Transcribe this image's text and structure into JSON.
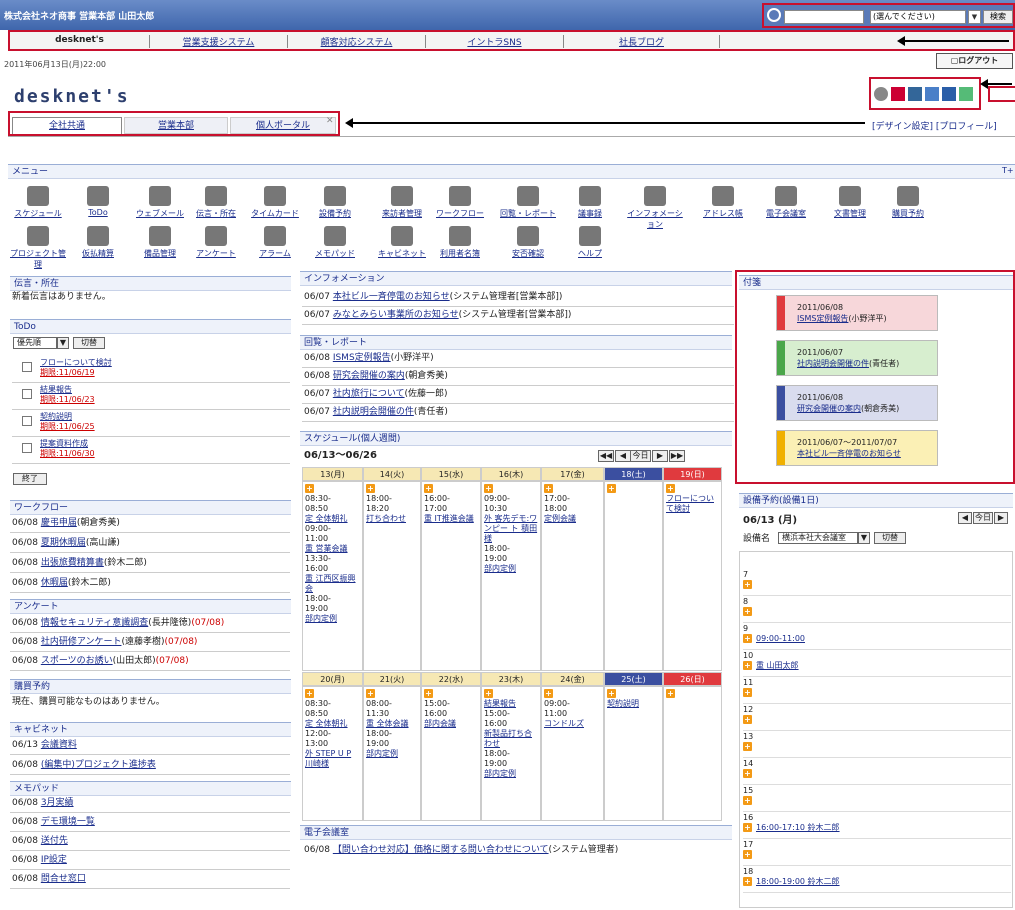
{
  "topbar": {
    "user": "株式会社ネオ商事 営業本部 山田太郎",
    "search_placeholder": "",
    "select_value": "(選んでください)",
    "search_button": "検索"
  },
  "nav": [
    "desknet's",
    "営業支援システム",
    "顧客対応システム",
    "イントラSNS",
    "社長ブログ"
  ],
  "date": "2011年06月13日(月)22:00",
  "logout": "ログアウト",
  "logo": "desknet's",
  "tabs": [
    "全社共通",
    "営業本部",
    "個人ポータル"
  ],
  "top_right": "[デザイン設定] [プロフィール]",
  "menu": {
    "title": "メニュー",
    "items1": [
      "スケジュール",
      "ToDo",
      "ウェブメール",
      "伝言・所在",
      "タイムカード",
      "設備予約",
      "来訪者管理",
      "ワークフロー",
      "回覧・レポート",
      "議事録",
      "インフォメーション",
      "アドレス帳",
      "電子会議室",
      "文書管理",
      "購買予約"
    ],
    "items2": [
      "プロジェクト管理",
      "仮払精算",
      "備品管理",
      "アンケート",
      "アラーム",
      "メモパッド",
      "キャビネット",
      "利用者名簿",
      "安否確認",
      "ヘルプ"
    ]
  },
  "dengon": {
    "title": "伝言・所在",
    "text": "新着伝言はありません。"
  },
  "todo": {
    "title": "ToDo",
    "sort": "優先順",
    "switch": "切替",
    "items": [
      {
        "t": "フローについて検討",
        "d": "期限:11/06/19"
      },
      {
        "t": "結果報告",
        "d": "期限:11/06/23"
      },
      {
        "t": "契約説明",
        "d": "期限:11/06/25"
      },
      {
        "t": "提案資料作成",
        "d": "期限:11/06/30"
      }
    ],
    "done": "終了"
  },
  "workflow": {
    "title": "ワークフロー",
    "rows": [
      {
        "d": "06/08",
        "l": "慶弔申届",
        "w": "(朝倉秀美)"
      },
      {
        "d": "06/08",
        "l": "夏期休暇届",
        "w": "(高山謙)"
      },
      {
        "d": "06/08",
        "l": "出張旅費精算書",
        "w": "(鈴木二郎)"
      },
      {
        "d": "06/08",
        "l": "休暇届",
        "w": "(鈴木二郎)"
      }
    ]
  },
  "enquete": {
    "title": "アンケート",
    "rows": [
      {
        "d": "06/08",
        "l": "情報セキュリティ意識調査",
        "w": "(長井隆徳)",
        "x": "(07/08)"
      },
      {
        "d": "06/08",
        "l": "社内研修アンケート",
        "w": "(遠藤孝樹)",
        "x": "(07/08)"
      },
      {
        "d": "06/08",
        "l": "スポーツのお誘い",
        "w": "(山田太郎)",
        "x": "(07/08)"
      }
    ]
  },
  "kobai": {
    "title": "購買予約",
    "text": "現在、購買可能なものはありません。"
  },
  "cabinet": {
    "title": "キャビネット",
    "rows": [
      {
        "d": "06/13",
        "l": "会議資料"
      },
      {
        "d": "06/08",
        "l": "(編集中)プロジェクト進捗表"
      }
    ]
  },
  "memo": {
    "title": "メモパッド",
    "rows": [
      {
        "d": "06/08",
        "l": "3月実績"
      },
      {
        "d": "06/08",
        "l": "デモ環境一覧"
      },
      {
        "d": "06/08",
        "l": "送付先"
      },
      {
        "d": "06/08",
        "l": "IP設定"
      },
      {
        "d": "06/08",
        "l": "問合せ窓口"
      }
    ]
  },
  "info": {
    "title": "インフォメーション",
    "rows": [
      {
        "d": "06/07",
        "l": "本社ビル一斉停電のお知らせ",
        "w": "(システム管理者[営業本部])"
      },
      {
        "d": "06/07",
        "l": "みなとみらい事業所のお知らせ",
        "w": "(システム管理者[営業本部])"
      }
    ]
  },
  "kairan": {
    "title": "回覧・レポート",
    "rows": [
      {
        "d": "06/08",
        "l": "ISMS定例報告",
        "w": "(小野洋平)"
      },
      {
        "d": "06/08",
        "l": "研究会開催の案内",
        "w": "(朝倉秀美)"
      },
      {
        "d": "06/07",
        "l": "社内旅行について",
        "w": "(佐藤一郎)"
      },
      {
        "d": "06/07",
        "l": "社内説明会開催の件",
        "w": "(青任者)"
      }
    ]
  },
  "schedule": {
    "title": "スケジュール(個人週間)",
    "range": "06/13〜06/26",
    "week1": [
      "13(月)",
      "14(火)",
      "15(水)",
      "16(木)",
      "17(金)",
      "18(土)",
      "19(日)"
    ],
    "week2": [
      "20(月)",
      "21(火)",
      "22(水)",
      "23(木)",
      "24(金)",
      "25(土)",
      "26(日)"
    ],
    "w1": [
      [
        "08:30-",
        "08:50",
        "定 全体朝礼",
        "09:00-",
        "11:00",
        "重 営業会議",
        "13:30-",
        "16:00",
        "重 江西区振興会",
        "18:00-",
        "19:00",
        "部内定例"
      ],
      [
        "18:00-",
        "18:20",
        "打ち合わせ"
      ],
      [
        "16:00-",
        "17:00",
        "重 IT推進会議"
      ],
      [
        "09:00-",
        "10:30",
        "外 客先デモ:ワンピー ト 積田様",
        "18:00-",
        "19:00",
        "部内定例"
      ],
      [
        "17:00-",
        "18:00",
        "定例会議"
      ],
      [],
      [
        "フローについて検討"
      ]
    ],
    "w2": [
      [
        "08:30-",
        "08:50",
        "定 全体朝礼",
        "12:00-",
        "13:00",
        "外 STEP U P 川崎様"
      ],
      [
        "08:00-",
        "11:30",
        "重 全体会議",
        "18:00-",
        "19:00",
        "部内定例"
      ],
      [
        "15:00-",
        "16:00",
        "部内会議"
      ],
      [
        "結果報告",
        "15:00-",
        "16:00",
        "新製品打ち合わせ",
        "18:00-",
        "19:00",
        "部内定例"
      ],
      [
        "09:00-",
        "11:00",
        "コンドルズ"
      ],
      [
        "契約説明"
      ],
      []
    ]
  },
  "kaigi": {
    "title": "電子会議室",
    "row": {
      "d": "06/08",
      "l": "【問い合わせ対応】価格に関する問い合わせについて",
      "w": "(システム管理者)"
    }
  },
  "fusen": {
    "title": "付箋",
    "items": [
      {
        "date": "2011/06/08",
        "l": "ISMS定例報告",
        "w": "(小野洋平)",
        "c": "#f7d7da",
        "b": "#e03a3e"
      },
      {
        "date": "2011/06/07",
        "l": "社内説明会開催の件",
        "w": "(青任者)",
        "c": "#d7eecf",
        "b": "#4aa64a"
      },
      {
        "date": "2011/06/08",
        "l": "研究会開催の案内",
        "w": "(朝倉秀美)",
        "c": "#d9dcee",
        "b": "#3b4fa0"
      },
      {
        "date": "2011/06/07〜2011/07/07",
        "l": "本社ビル一斉停電のお知らせ",
        "w": "",
        "c": "#fbf0b5",
        "b": "#f0b000"
      }
    ]
  },
  "setsubi": {
    "title": "設備予約(設備1日)",
    "date": "06/13 (月)",
    "label": "設備名",
    "facility": "横浜本社大会議室",
    "switch": "切替",
    "slots": [
      {
        "h": "7"
      },
      {
        "h": "8"
      },
      {
        "h": "9",
        "e": "09:00-11:00"
      },
      {
        "h": "10",
        "e": "重 山田太郎"
      },
      {
        "h": "11"
      },
      {
        "h": "12"
      },
      {
        "h": "13"
      },
      {
        "h": "14"
      },
      {
        "h": "15"
      },
      {
        "h": "16",
        "e": "16:00-17:10 鈴木二郎"
      },
      {
        "h": "17"
      },
      {
        "h": "18",
        "e": "18:00-19:00 鈴木二郎"
      }
    ]
  }
}
